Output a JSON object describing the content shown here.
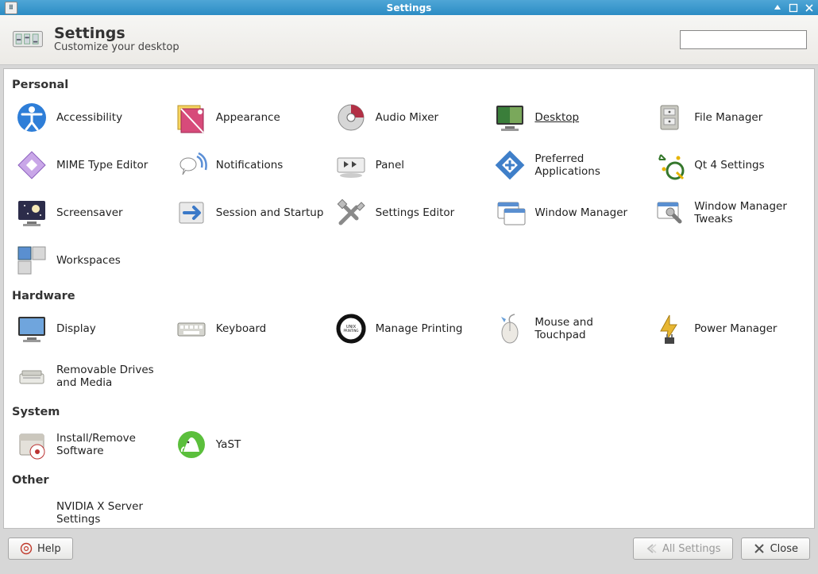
{
  "window": {
    "title": "Settings"
  },
  "header": {
    "title": "Settings",
    "subtitle": "Customize your desktop",
    "search_placeholder": ""
  },
  "sections": [
    {
      "title": "Personal",
      "items": [
        {
          "label": "Accessibility",
          "icon": "accessibility",
          "selected": false
        },
        {
          "label": "Appearance",
          "icon": "appearance",
          "selected": false
        },
        {
          "label": "Audio Mixer",
          "icon": "audio-mixer",
          "selected": false
        },
        {
          "label": "Desktop",
          "icon": "desktop",
          "selected": true
        },
        {
          "label": "File Manager",
          "icon": "file-manager",
          "selected": false
        },
        {
          "label": "MIME Type Editor",
          "icon": "mime-editor",
          "selected": false
        },
        {
          "label": "Notifications",
          "icon": "notifications",
          "selected": false
        },
        {
          "label": "Panel",
          "icon": "panel",
          "selected": false
        },
        {
          "label": "Preferred Applications",
          "icon": "preferred-apps",
          "selected": false
        },
        {
          "label": "Qt 4 Settings",
          "icon": "qt4",
          "selected": false
        },
        {
          "label": "Screensaver",
          "icon": "screensaver",
          "selected": false
        },
        {
          "label": "Session and Startup",
          "icon": "session",
          "selected": false
        },
        {
          "label": "Settings Editor",
          "icon": "settings-editor",
          "selected": false
        },
        {
          "label": "Window Manager",
          "icon": "window-manager",
          "selected": false
        },
        {
          "label": "Window Manager Tweaks",
          "icon": "wm-tweaks",
          "selected": false
        },
        {
          "label": "Workspaces",
          "icon": "workspaces",
          "selected": false
        }
      ]
    },
    {
      "title": "Hardware",
      "items": [
        {
          "label": "Display",
          "icon": "display",
          "selected": false
        },
        {
          "label": "Keyboard",
          "icon": "keyboard",
          "selected": false
        },
        {
          "label": "Manage Printing",
          "icon": "printing",
          "selected": false
        },
        {
          "label": "Mouse and Touchpad",
          "icon": "mouse",
          "selected": false
        },
        {
          "label": "Power Manager",
          "icon": "power",
          "selected": false
        },
        {
          "label": "Removable Drives and Media",
          "icon": "removable",
          "selected": false
        }
      ]
    },
    {
      "title": "System",
      "items": [
        {
          "label": "Install/Remove Software",
          "icon": "software",
          "selected": false
        },
        {
          "label": "YaST",
          "icon": "yast",
          "selected": false
        }
      ]
    },
    {
      "title": "Other",
      "items": [
        {
          "label": "NVIDIA X Server Settings",
          "icon": "none",
          "selected": false
        }
      ]
    }
  ],
  "footer": {
    "help_label": "Help",
    "all_settings_label": "All Settings",
    "close_label": "Close"
  }
}
